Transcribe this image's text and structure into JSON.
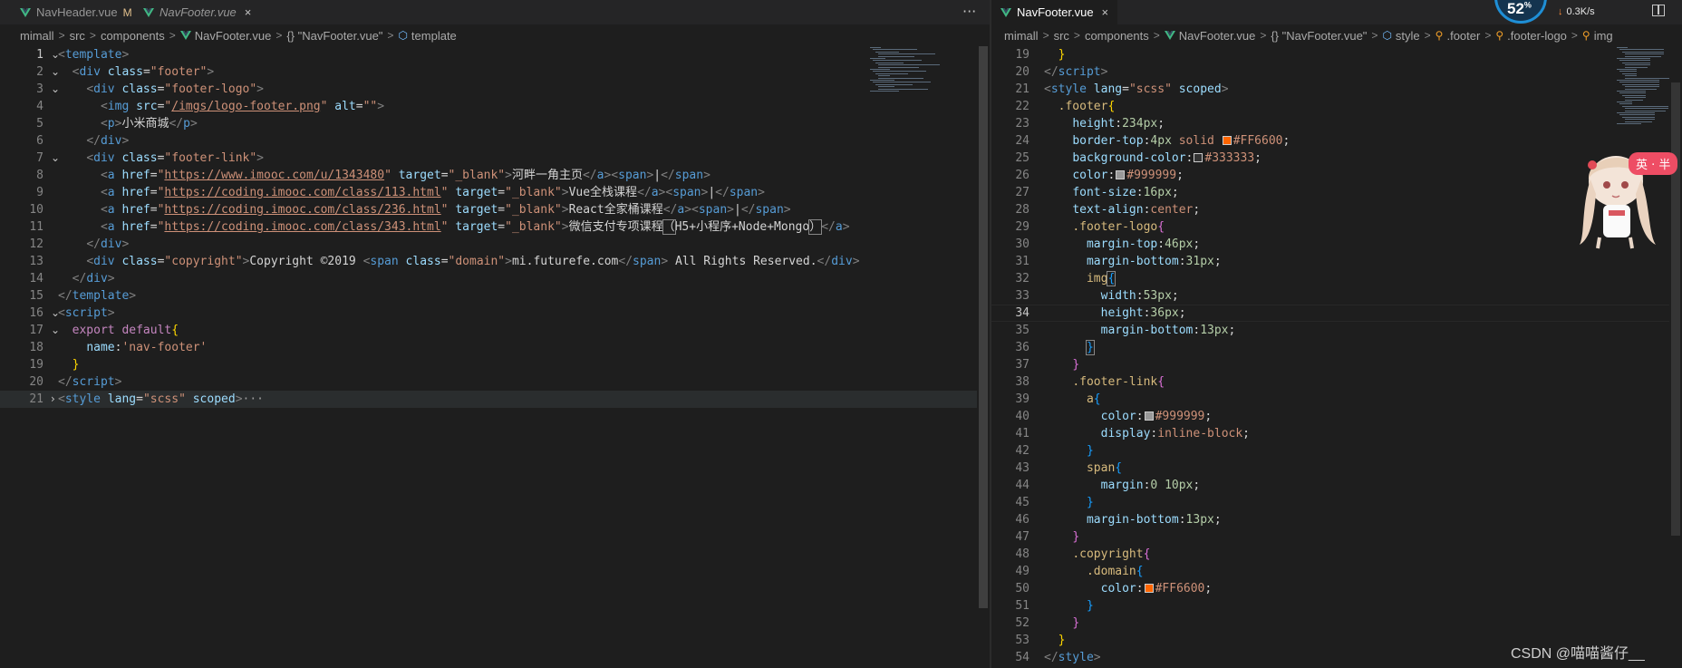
{
  "left": {
    "tabs": [
      {
        "name": "NavHeader.vue",
        "badge": "M",
        "active": false,
        "italic": false
      },
      {
        "name": "NavFooter.vue",
        "close": "×",
        "active": false,
        "italic": true
      }
    ],
    "more": "···",
    "breadcrumb": [
      "mimall",
      "src",
      "components",
      "NavFooter.vue",
      "{} \"NavFooter.vue\"",
      "template"
    ],
    "lines": [
      {
        "n": "1",
        "fold": "v",
        "html": "<span class=\"t-br\">&lt;</span><span class=\"t-tag\">template</span><span class=\"t-br\">&gt;</span>"
      },
      {
        "n": "2",
        "fold": "v",
        "html": "  <span class=\"t-br\">&lt;</span><span class=\"t-tag\">div</span> <span class=\"t-attr\">class</span>=<span class=\"t-str\">\"footer\"</span><span class=\"t-br\">&gt;</span>"
      },
      {
        "n": "3",
        "fold": "v",
        "html": "    <span class=\"t-br\">&lt;</span><span class=\"t-tag\">div</span> <span class=\"t-attr\">class</span>=<span class=\"t-str\">\"footer-logo\"</span><span class=\"t-br\">&gt;</span>"
      },
      {
        "n": "4",
        "fold": "",
        "html": "      <span class=\"t-br\">&lt;</span><span class=\"t-tag\">img</span> <span class=\"t-attr\">src</span>=<span class=\"t-str\">\"</span><span class=\"t-url\">/imgs/logo-footer.png</span><span class=\"t-str\">\"</span> <span class=\"t-attr\">alt</span>=<span class=\"t-str\">\"\"</span><span class=\"t-br\">&gt;</span>"
      },
      {
        "n": "5",
        "fold": "",
        "html": "      <span class=\"t-br\">&lt;</span><span class=\"t-tag\">p</span><span class=\"t-br\">&gt;</span><span class=\"t-text\">小米商城</span><span class=\"t-br\">&lt;/</span><span class=\"t-tag\">p</span><span class=\"t-br\">&gt;</span>"
      },
      {
        "n": "6",
        "fold": "",
        "html": "    <span class=\"t-br\">&lt;/</span><span class=\"t-tag\">div</span><span class=\"t-br\">&gt;</span>"
      },
      {
        "n": "7",
        "fold": "v",
        "html": "    <span class=\"t-br\">&lt;</span><span class=\"t-tag\">div</span> <span class=\"t-attr\">class</span>=<span class=\"t-str\">\"footer-link\"</span><span class=\"t-br\">&gt;</span>"
      },
      {
        "n": "8",
        "fold": "",
        "html": "      <span class=\"t-br\">&lt;</span><span class=\"t-tag\">a</span> <span class=\"t-attr\">href</span>=<span class=\"t-str\">\"</span><span class=\"t-url\">https://www.imooc.com/u/1343480</span><span class=\"t-str\">\"</span> <span class=\"t-attr\">target</span>=<span class=\"t-str\">\"_blank\"</span><span class=\"t-br\">&gt;</span><span class=\"t-text\">河畔一角主页</span><span class=\"t-br\">&lt;/</span><span class=\"t-tag\">a</span><span class=\"t-br\">&gt;&lt;</span><span class=\"t-tag\">span</span><span class=\"t-br\">&gt;</span><span class=\"t-text\">|</span><span class=\"t-br\">&lt;/</span><span class=\"t-tag\">span</span><span class=\"t-br\">&gt;</span>"
      },
      {
        "n": "9",
        "fold": "",
        "html": "      <span class=\"t-br\">&lt;</span><span class=\"t-tag\">a</span> <span class=\"t-attr\">href</span>=<span class=\"t-str\">\"</span><span class=\"t-url\">https://coding.imooc.com/class/113.html</span><span class=\"t-str\">\"</span> <span class=\"t-attr\">target</span>=<span class=\"t-str\">\"_blank\"</span><span class=\"t-br\">&gt;</span><span class=\"t-text\">Vue全栈课程</span><span class=\"t-br\">&lt;/</span><span class=\"t-tag\">a</span><span class=\"t-br\">&gt;&lt;</span><span class=\"t-tag\">span</span><span class=\"t-br\">&gt;</span><span class=\"t-text\">|</span><span class=\"t-br\">&lt;/</span><span class=\"t-tag\">span</span><span class=\"t-br\">&gt;</span>"
      },
      {
        "n": "10",
        "fold": "",
        "html": "      <span class=\"t-br\">&lt;</span><span class=\"t-tag\">a</span> <span class=\"t-attr\">href</span>=<span class=\"t-str\">\"</span><span class=\"t-url\">https://coding.imooc.com/class/236.html</span><span class=\"t-str\">\"</span> <span class=\"t-attr\">target</span>=<span class=\"t-str\">\"_blank\"</span><span class=\"t-br\">&gt;</span><span class=\"t-text\">React全家桶课程</span><span class=\"t-br\">&lt;/</span><span class=\"t-tag\">a</span><span class=\"t-br\">&gt;&lt;</span><span class=\"t-tag\">span</span><span class=\"t-br\">&gt;</span><span class=\"t-text\">|</span><span class=\"t-br\">&lt;/</span><span class=\"t-tag\">span</span><span class=\"t-br\">&gt;</span>"
      },
      {
        "n": "11",
        "fold": "",
        "html": "      <span class=\"t-br\">&lt;</span><span class=\"t-tag\">a</span> <span class=\"t-attr\">href</span>=<span class=\"t-str\">\"</span><span class=\"t-url\">https://coding.imooc.com/class/343.html</span><span class=\"t-str\">\"</span> <span class=\"t-attr\">target</span>=<span class=\"t-str\">\"_blank\"</span><span class=\"t-br\">&gt;</span><span class=\"t-text\">微信支付专项课程<span class=\"bracket-box\">（</span>H5+小程序+Node+Mongo<span class=\"bracket-box\">）</span></span><span class=\"t-br\">&lt;/</span><span class=\"t-tag\">a</span><span class=\"t-br\">&gt;</span>"
      },
      {
        "n": "12",
        "fold": "",
        "html": "    <span class=\"t-br\">&lt;/</span><span class=\"t-tag\">div</span><span class=\"t-br\">&gt;</span>"
      },
      {
        "n": "13",
        "fold": "",
        "html": "    <span class=\"t-br\">&lt;</span><span class=\"t-tag\">div</span> <span class=\"t-attr\">class</span>=<span class=\"t-str\">\"copyright\"</span><span class=\"t-br\">&gt;</span><span class=\"t-text\">Copyright ©2019 </span><span class=\"t-br\">&lt;</span><span class=\"t-tag\">span</span> <span class=\"t-attr\">class</span>=<span class=\"t-str\">\"domain\"</span><span class=\"t-br\">&gt;</span><span class=\"t-text\">mi.futurefe.com</span><span class=\"t-br\">&lt;/</span><span class=\"t-tag\">span</span><span class=\"t-br\">&gt;</span><span class=\"t-text\"> All Rights Reserved.</span><span class=\"t-br\">&lt;/</span><span class=\"t-tag\">div</span><span class=\"t-br\">&gt;</span>"
      },
      {
        "n": "14",
        "fold": "",
        "html": "  <span class=\"t-br\">&lt;/</span><span class=\"t-tag\">div</span><span class=\"t-br\">&gt;</span>"
      },
      {
        "n": "15",
        "fold": "",
        "html": "<span class=\"t-br\">&lt;/</span><span class=\"t-tag\">template</span><span class=\"t-br\">&gt;</span>"
      },
      {
        "n": "16",
        "fold": "v",
        "html": "<span class=\"t-br\">&lt;</span><span class=\"t-tag\">script</span><span class=\"t-br\">&gt;</span>"
      },
      {
        "n": "17",
        "fold": "v",
        "html": "  <span class=\"t-kw\">export</span> <span class=\"t-kw\">default</span><span class=\"t-brace1\">{</span>"
      },
      {
        "n": "18",
        "fold": "",
        "html": "    <span class=\"t-attr\">name</span>:<span class=\"t-str\">'nav-footer'</span>"
      },
      {
        "n": "19",
        "fold": "",
        "html": "  <span class=\"t-brace1\">}</span>"
      },
      {
        "n": "20",
        "fold": "",
        "html": "<span class=\"t-br\">&lt;/</span><span class=\"t-tag\">script</span><span class=\"t-br\">&gt;</span>"
      },
      {
        "n": "21",
        "fold": ">",
        "hl": true,
        "html": "<span class=\"t-br\">&lt;</span><span class=\"t-tag\">style</span> <span class=\"t-attr\">lang</span>=<span class=\"t-str\">\"scss\"</span> <span class=\"t-attr\">scoped</span><span class=\"t-br\">&gt;</span><span class=\"t-ell\">···</span>"
      }
    ],
    "current_line": "1"
  },
  "right": {
    "tabs": [
      {
        "name": "NavFooter.vue",
        "close": "×",
        "active": true,
        "italic": false
      }
    ],
    "breadcrumb": [
      "mimall",
      "src",
      "components",
      "NavFooter.vue",
      "{} \"NavFooter.vue\"",
      "style",
      ".footer",
      ".footer-logo",
      "img"
    ],
    "lines": [
      {
        "n": "19",
        "fold": "",
        "html": "  <span class=\"t-brace1\">}</span>"
      },
      {
        "n": "20",
        "fold": "",
        "html": "<span class=\"t-br\">&lt;/</span><span class=\"t-tag\">script</span><span class=\"t-br\">&gt;</span>"
      },
      {
        "n": "21",
        "fold": "",
        "html": "<span class=\"t-br\">&lt;</span><span class=\"t-tag\">style</span> <span class=\"t-attr\">lang</span>=<span class=\"t-str\">\"scss\"</span> <span class=\"t-attr\">scoped</span><span class=\"t-br\">&gt;</span>"
      },
      {
        "n": "22",
        "fold": "",
        "html": "  <span class=\"t-sel\">.footer</span><span class=\"t-brace1\">{</span>"
      },
      {
        "n": "23",
        "fold": "",
        "html": "    <span class=\"t-prop\">height</span>:<span class=\"t-num\">234px</span>;"
      },
      {
        "n": "24",
        "fold": "",
        "html": "    <span class=\"t-prop\">border-top</span>:<span class=\"t-num\">4px</span> <span class=\"t-val\">solid</span> <span class=\"swatch\" style=\"background:#FF6600\"></span><span class=\"t-val\">#FF6600</span>;"
      },
      {
        "n": "25",
        "fold": "",
        "html": "    <span class=\"t-prop\">background-color</span>:<span class=\"swatch\" style=\"background:#333333\"></span><span class=\"t-val\">#333333</span>;"
      },
      {
        "n": "26",
        "fold": "",
        "html": "    <span class=\"t-prop\">color</span>:<span class=\"swatch\" style=\"background:#999999\"></span><span class=\"t-val\">#999999</span>;"
      },
      {
        "n": "27",
        "fold": "",
        "html": "    <span class=\"t-prop\">font-size</span>:<span class=\"t-num\">16px</span>;"
      },
      {
        "n": "28",
        "fold": "",
        "html": "    <span class=\"t-prop\">text-align</span>:<span class=\"t-val\">center</span>;"
      },
      {
        "n": "29",
        "fold": "",
        "html": "    <span class=\"t-sel\">.footer-logo</span><span class=\"t-brace2\">{</span>"
      },
      {
        "n": "30",
        "fold": "",
        "html": "      <span class=\"t-prop\">margin-top</span>:<span class=\"t-num\">46px</span>;"
      },
      {
        "n": "31",
        "fold": "",
        "html": "      <span class=\"t-prop\">margin-bottom</span>:<span class=\"t-num\">31px</span>;"
      },
      {
        "n": "32",
        "fold": "",
        "html": "      <span class=\"t-sel\">img</span><span class=\"t-brace3 bracket-box\">{</span>"
      },
      {
        "n": "33",
        "fold": "",
        "html": "        <span class=\"t-prop\">width</span>:<span class=\"t-num\">53px</span>;"
      },
      {
        "n": "34",
        "fold": "",
        "cur": true,
        "html": "        <span class=\"t-prop\">height</span>:<span class=\"t-num\">36px</span>;"
      },
      {
        "n": "35",
        "fold": "",
        "html": "        <span class=\"t-prop\">margin-bottom</span>:<span class=\"t-num\">13px</span>;"
      },
      {
        "n": "36",
        "fold": "",
        "html": "      <span class=\"t-brace3 bracket-box\">}</span>"
      },
      {
        "n": "37",
        "fold": "",
        "html": "    <span class=\"t-brace2\">}</span>"
      },
      {
        "n": "38",
        "fold": "",
        "html": "    <span class=\"t-sel\">.footer-link</span><span class=\"t-brace2\">{</span>"
      },
      {
        "n": "39",
        "fold": "",
        "html": "      <span class=\"t-sel\">a</span><span class=\"t-brace3\">{</span>"
      },
      {
        "n": "40",
        "fold": "",
        "html": "        <span class=\"t-prop\">color</span>:<span class=\"swatch\" style=\"background:#999999\"></span><span class=\"t-val\">#999999</span>;"
      },
      {
        "n": "41",
        "fold": "",
        "html": "        <span class=\"t-prop\">display</span>:<span class=\"t-val\">inline-block</span>;"
      },
      {
        "n": "42",
        "fold": "",
        "html": "      <span class=\"t-brace3\">}</span>"
      },
      {
        "n": "43",
        "fold": "",
        "html": "      <span class=\"t-sel\">span</span><span class=\"t-brace3\">{</span>"
      },
      {
        "n": "44",
        "fold": "",
        "html": "        <span class=\"t-prop\">margin</span>:<span class=\"t-num\">0</span> <span class=\"t-num\">10px</span>;"
      },
      {
        "n": "45",
        "fold": "",
        "html": "      <span class=\"t-brace3\">}</span>"
      },
      {
        "n": "46",
        "fold": "",
        "html": "      <span class=\"t-prop\">margin-bottom</span>:<span class=\"t-num\">13px</span>;"
      },
      {
        "n": "47",
        "fold": "",
        "html": "    <span class=\"t-brace2\">}</span>"
      },
      {
        "n": "48",
        "fold": "",
        "html": "    <span class=\"t-sel\">.copyright</span><span class=\"t-brace2\">{</span>"
      },
      {
        "n": "49",
        "fold": "",
        "html": "      <span class=\"t-sel\">.domain</span><span class=\"t-brace3\">{</span>"
      },
      {
        "n": "50",
        "fold": "",
        "html": "        <span class=\"t-prop\">color</span>:<span class=\"swatch\" style=\"background:#FF6600\"></span><span class=\"t-val\">#FF6600</span>;"
      },
      {
        "n": "51",
        "fold": "",
        "html": "      <span class=\"t-brace3\">}</span>"
      },
      {
        "n": "52",
        "fold": "",
        "html": "    <span class=\"t-brace2\">}</span>"
      },
      {
        "n": "53",
        "fold": "",
        "html": "  <span class=\"t-brace1\">}</span>"
      },
      {
        "n": "54",
        "fold": "",
        "html": "<span class=\"t-br\">&lt;/</span><span class=\"t-tag\">style</span><span class=\"t-br\">&gt;</span>"
      }
    ],
    "current_line": "34"
  },
  "speed_widget": {
    "percent": "52",
    "percent_unit": "%",
    "rate": "0.3K/s",
    "arrow": "↓"
  },
  "ime_bubble": "英 · 半",
  "watermark": "CSDN @喵喵酱仔__",
  "colors": {
    "accent_orange": "#FF6600",
    "editor_bg": "#1e1e1e",
    "tabbar_bg": "#252526",
    "speed_ring": "#1f8fd6"
  },
  "icons": [
    "vue-icon",
    "close-icon",
    "more-icon",
    "chevron-right-icon",
    "braces-icon",
    "cube-icon",
    "css-class-icon",
    "split-editor-icon",
    "fold-chevron-icon"
  ]
}
